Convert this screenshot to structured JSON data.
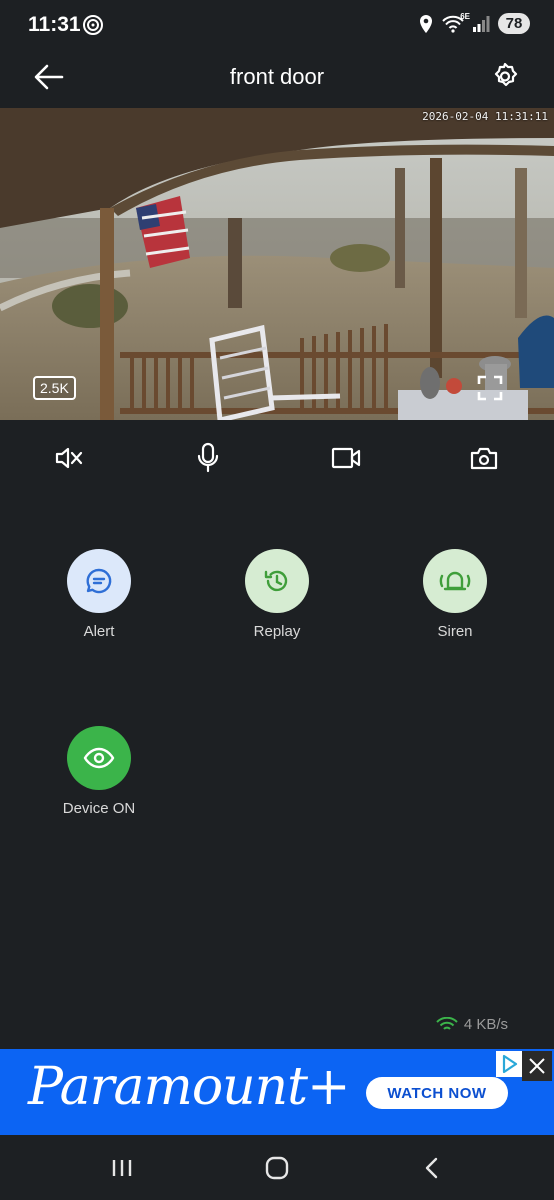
{
  "status_bar": {
    "time": "11:31",
    "network_label": "6E",
    "battery": "78"
  },
  "header": {
    "title": "front door"
  },
  "video": {
    "timestamp": "2026-02-04 11:31:11",
    "resolution_badge": "2.5K"
  },
  "controls": [
    {
      "name": "mute",
      "icon": "speaker-muted-icon"
    },
    {
      "name": "talk",
      "icon": "microphone-icon"
    },
    {
      "name": "record",
      "icon": "video-camera-icon"
    },
    {
      "name": "snapshot",
      "icon": "camera-icon"
    }
  ],
  "actions": {
    "alert": {
      "label": "Alert",
      "icon": "chat-bubble-icon",
      "bg": "#dce8fa",
      "fg": "#2f6fd6"
    },
    "replay": {
      "label": "Replay",
      "icon": "clock-history-icon",
      "bg": "#d6ecd2",
      "fg": "#3f9e3a"
    },
    "siren": {
      "label": "Siren",
      "icon": "siren-icon",
      "bg": "#d6ecd2",
      "fg": "#3f9e3a"
    },
    "device": {
      "label": "Device ON",
      "icon": "eye-icon",
      "bg": "#3bb44a",
      "fg": "#ffffff"
    }
  },
  "network_speed": "4 KB/s",
  "ad": {
    "brand": "Paramount+",
    "cta": "WATCH NOW",
    "bg": "#0c64f3"
  }
}
